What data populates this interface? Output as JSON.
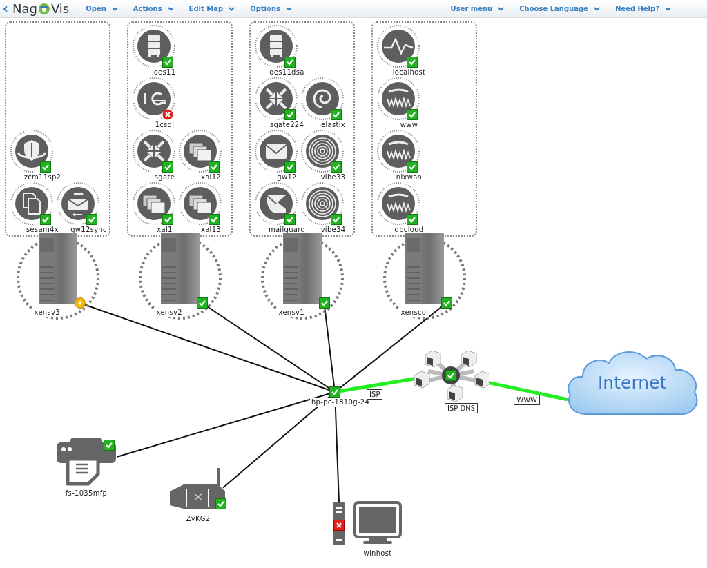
{
  "header": {
    "logo": {
      "left": "Nag",
      "right": "Vis"
    },
    "menus_left": [
      {
        "label": "Open"
      },
      {
        "label": "Actions"
      },
      {
        "label": "Edit Map"
      },
      {
        "label": "Options"
      }
    ],
    "menus_right": [
      {
        "label": "User menu"
      },
      {
        "label": "Choose Language"
      },
      {
        "label": "Need Help?"
      }
    ]
  },
  "groups": [
    {
      "rows": [
        [
          {
            "name": "zcm11sp2",
            "kind": "shield",
            "critical": false,
            "warning": false
          }
        ],
        [
          {
            "name": "sesam4x",
            "kind": "documents",
            "critical": false,
            "warning": false
          },
          {
            "name": "gw12sync",
            "kind": "mailsync",
            "critical": false,
            "warning": false
          }
        ]
      ],
      "server": {
        "name": "xensv3",
        "critical": false,
        "warning": true
      }
    },
    {
      "rows": [
        [
          {
            "name": "oes11",
            "kind": "server",
            "critical": false,
            "warning": false
          }
        ],
        [
          {
            "name": "1csql",
            "kind": "onec",
            "critical": true,
            "warning": false
          }
        ],
        [
          {
            "name": "sgate",
            "kind": "arrows",
            "critical": false,
            "warning": false
          },
          {
            "name": "xal12",
            "kind": "windows",
            "critical": false,
            "warning": false
          }
        ],
        [
          {
            "name": "xal1",
            "kind": "windows",
            "critical": false,
            "warning": false
          },
          {
            "name": "xal13",
            "kind": "windows",
            "critical": false,
            "warning": false
          }
        ]
      ],
      "server": {
        "name": "xensv2",
        "critical": false,
        "warning": false
      }
    },
    {
      "rows": [
        [
          {
            "name": "oes11dsa",
            "kind": "server",
            "critical": false,
            "warning": false
          }
        ],
        [
          {
            "name": "sgate224",
            "kind": "arrows",
            "critical": false,
            "warning": false
          },
          {
            "name": "elastix",
            "kind": "spiral",
            "critical": false,
            "warning": false
          }
        ],
        [
          {
            "name": "gw12",
            "kind": "mail",
            "critical": false,
            "warning": false
          },
          {
            "name": "vibe33",
            "kind": "target",
            "critical": false,
            "warning": false
          }
        ],
        [
          {
            "name": "mailguard",
            "kind": "mailguard",
            "critical": false,
            "warning": false
          },
          {
            "name": "vibe34",
            "kind": "target",
            "critical": false,
            "warning": false
          }
        ]
      ],
      "server": {
        "name": "xensv1",
        "critical": false,
        "warning": false
      }
    },
    {
      "rows": [
        [
          {
            "name": "localhost",
            "kind": "pulse",
            "critical": false,
            "warning": false
          }
        ],
        [
          {
            "name": "www",
            "kind": "www",
            "critical": false,
            "warning": false
          }
        ],
        [
          {
            "name": "nixwan",
            "kind": "www",
            "critical": false,
            "warning": false
          }
        ],
        [
          {
            "name": "dbcloud",
            "kind": "www",
            "critical": false,
            "warning": false
          }
        ]
      ],
      "server": {
        "name": "xenscol",
        "critical": false,
        "warning": false
      }
    }
  ],
  "switch": {
    "name": "hp-pc-1810g-24",
    "critical": false,
    "warning": false
  },
  "devices": [
    {
      "kind": "printer",
      "name": "fs-1035mfp",
      "critical": false,
      "warning": false
    },
    {
      "kind": "router",
      "name": "ZyKG2",
      "critical": false,
      "warning": false
    },
    {
      "kind": "workstation",
      "name": "winhost",
      "critical": true,
      "warning": false
    }
  ],
  "dns": {
    "name": "ISP DNS",
    "critical": false,
    "warning": false
  },
  "uplinks": [
    {
      "label": "ISP",
      "down": false
    },
    {
      "label": "WWW",
      "down": false
    }
  ],
  "cloud": {
    "label": "Internet"
  }
}
